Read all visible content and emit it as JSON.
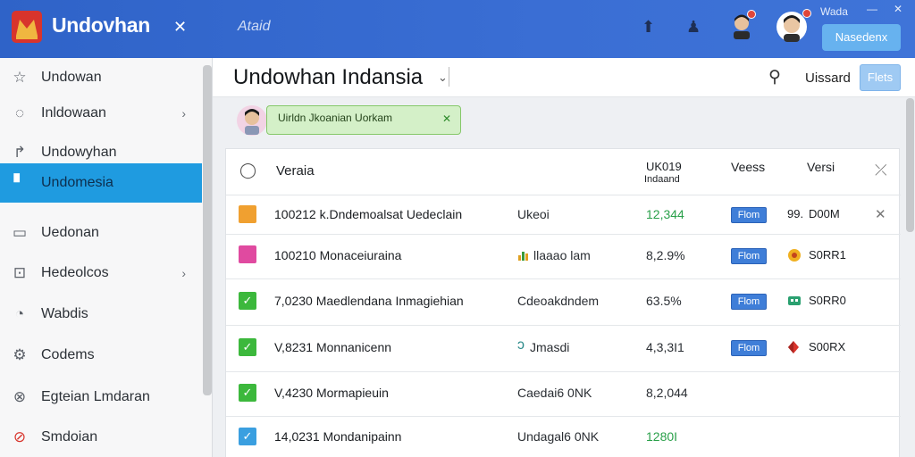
{
  "colors": {
    "topbar": "#3a6ed4",
    "active": "#1f9be0",
    "badge": "#3f7ed8",
    "chip": "#d4f0c8"
  },
  "topbar": {
    "app_title": "Undovhan",
    "search_text": "Ataid",
    "window_title": "Wada",
    "action_button": "Nasedenx"
  },
  "sidebar": {
    "items": [
      {
        "label": "Undowan",
        "icon": "star-icon"
      },
      {
        "label": "Inldowaan",
        "icon": "chat-icon"
      },
      {
        "label": "Undowyhan",
        "icon": "share-icon"
      },
      {
        "label": "Undomesia",
        "icon": "bookmark-icon"
      },
      {
        "label": "Uedonan",
        "icon": "monitor-icon"
      },
      {
        "label": "Hedeolcos",
        "icon": "terminal-icon"
      },
      {
        "label": "Wabdis",
        "icon": "leaf-icon"
      },
      {
        "label": "Codems",
        "icon": "gear-icon"
      },
      {
        "label": "Egteian Lmdaran",
        "icon": "tools-icon"
      },
      {
        "label": "Smdoian",
        "icon": "alert-icon"
      }
    ]
  },
  "header": {
    "title": "Undowhan Indansia",
    "user": "Uissard",
    "button": "Flets"
  },
  "chip": {
    "text": "Uirldn Jkoanian Uorkam"
  },
  "table": {
    "headers": {
      "name": "Veraia",
      "col2_line1": "UK019",
      "col2_line2": "Indaand",
      "col3": "Veess",
      "col4": "Versi"
    },
    "rows": [
      {
        "name": "100212 k.Dndemoalsat Uedeclain",
        "type": "Ukeoi",
        "pct": "12,344",
        "badge": "Flom",
        "val_icon": "99.",
        "val": "D00M",
        "chk_color": "#f0a030",
        "chk_mark": "",
        "pct_green": true
      },
      {
        "name": "100210 Monaceiuraina",
        "type": "llaaao lam",
        "type_icon": "bar-chart-icon",
        "pct": "8,2.9%",
        "badge": "Flom",
        "val_icon": "coin-icon",
        "val": "S0RR1",
        "chk_color": "#e04aa0",
        "chk_mark": "",
        "pct_green": false
      },
      {
        "name": "7,0230 Maedlendana Inmagiehian",
        "type": "Cdeoakdndem",
        "pct": "63.5%",
        "badge": "Flom",
        "val_icon": "grid-icon",
        "val": "S0RR0",
        "chk_color": "#3cb83c",
        "chk_mark": "✓",
        "pct_green": false
      },
      {
        "name": "V,8231 Monnanicenn",
        "type": "Jmasdi",
        "type_icon": "hook-icon",
        "pct": "4,3,3I1",
        "badge": "Flom",
        "val_icon": "diamond-icon",
        "val": "S00RX",
        "chk_color": "#3cb83c",
        "chk_mark": "✓",
        "pct_green": false
      },
      {
        "name": "V,4230 Mormapieuin",
        "type": "Caedai6 0NK",
        "pct": "8,2,044",
        "badge": "",
        "val": "",
        "chk_color": "#3cb83c",
        "chk_mark": "✓",
        "pct_green": false
      },
      {
        "name": "14,0231 Mondanipainn",
        "type": "Undagal6 0NK",
        "pct": "1280I",
        "badge": "",
        "val": "",
        "chk_color": "#3a9fe0",
        "chk_mark": "✓",
        "pct_green": true
      }
    ]
  }
}
